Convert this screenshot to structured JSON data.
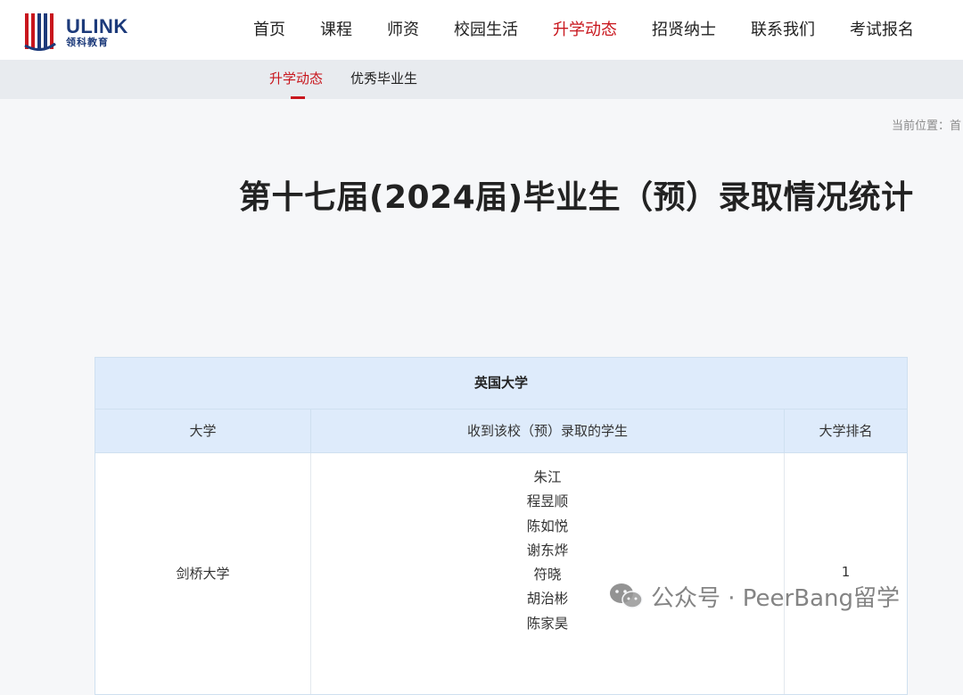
{
  "brand": {
    "name": "ULINK",
    "sub": "领科教育"
  },
  "nav": {
    "items": [
      {
        "label": "首页"
      },
      {
        "label": "课程"
      },
      {
        "label": "师资"
      },
      {
        "label": "校园生活"
      },
      {
        "label": "升学动态"
      },
      {
        "label": "招贤纳士"
      },
      {
        "label": "联系我们"
      },
      {
        "label": "考试报名"
      }
    ],
    "active": "升学动态"
  },
  "subnav": {
    "items": [
      {
        "label": "升学动态"
      },
      {
        "label": "优秀毕业生"
      }
    ],
    "active": "升学动态"
  },
  "breadcrumb": {
    "label": "当前位置：首"
  },
  "page": {
    "title": "第十七届(2024届)毕业生（预）录取情况统计"
  },
  "table": {
    "caption": "英国大学",
    "headers": [
      "大学",
      "收到该校（预）录取的学生",
      "大学排名"
    ],
    "rows": [
      {
        "university": "剑桥大学",
        "students": [
          "朱江",
          "程昱顺",
          "陈如悦",
          "谢东烨",
          "符晓",
          "胡治彬",
          "陈家昊"
        ],
        "rank": "1"
      }
    ]
  },
  "watermark": {
    "text": "公众号 · PeerBang留学"
  },
  "colors": {
    "accent": "#c8161d",
    "brand": "#1c3a7a",
    "table_header_bg": "#deebfb"
  }
}
